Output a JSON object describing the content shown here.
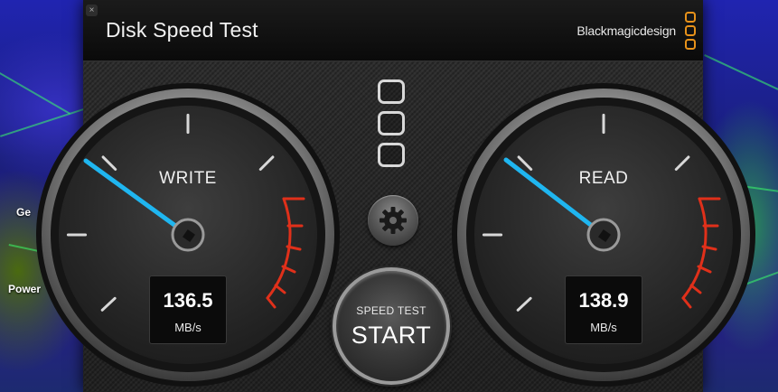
{
  "desktop": {
    "labels": [
      "Ge",
      "Power"
    ]
  },
  "window": {
    "close_glyph": "×",
    "title": "Disk Speed Test",
    "brand": "Blackmagicdesign"
  },
  "write_gauge": {
    "label": "WRITE",
    "value": "136.5",
    "unit": "MB/s"
  },
  "read_gauge": {
    "label": "READ",
    "value": "138.9",
    "unit": "MB/s"
  },
  "start_button": {
    "top_label": "SPEED TEST",
    "main_label": "START"
  },
  "icons": {
    "settings": "gear-icon",
    "drive_select": "drive-slots-icon",
    "close": "close-icon"
  },
  "colors": {
    "needle": "#1fb6f0",
    "redline": "#e0301a",
    "brand_orange": "#e8921a"
  }
}
